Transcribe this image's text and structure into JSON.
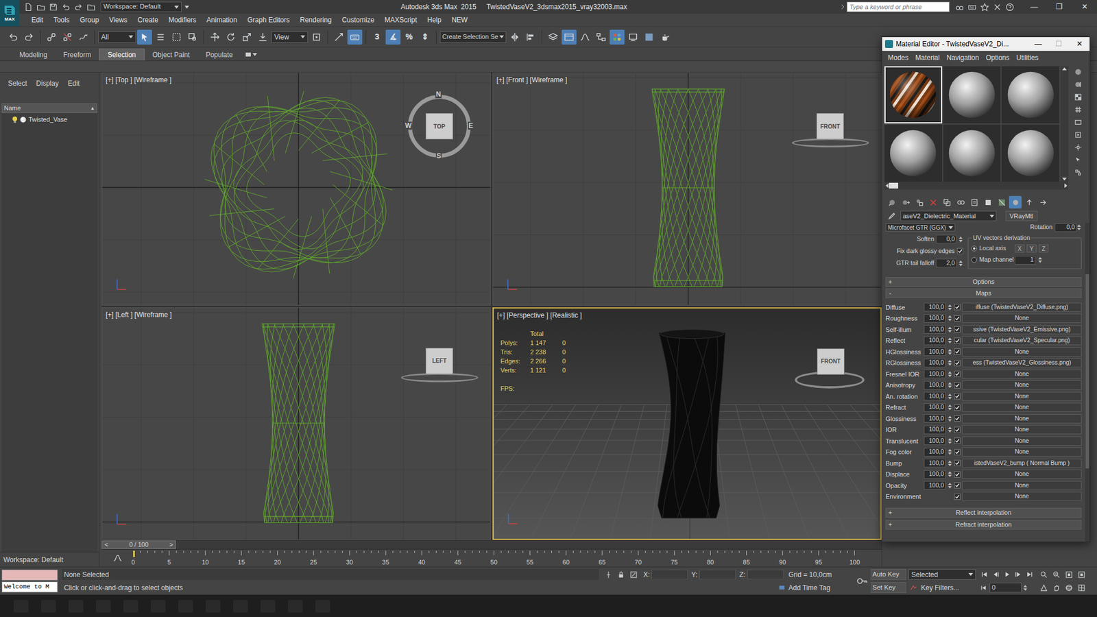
{
  "window": {
    "logo": "MAX",
    "workspace": "Workspace: Default",
    "title": "Autodesk 3ds Max  2015",
    "file": "TwistedVaseV2_3dsmax2015_vray32003.max",
    "search_placeholder": "Type a keyword or phrase",
    "controls": [
      "—",
      "❐",
      "✕"
    ]
  },
  "menu": [
    "Edit",
    "Tools",
    "Group",
    "Views",
    "Create",
    "Modifiers",
    "Animation",
    "Graph Editors",
    "Rendering",
    "Customize",
    "MAXScript",
    "Help",
    "NEW"
  ],
  "toolbar": {
    "filter": "All",
    "coord": "View",
    "snaps": [
      "3",
      "∡",
      "%",
      "⇕"
    ],
    "selection_set": "Create Selection Se"
  },
  "ribbon": {
    "tabs": [
      {
        "label": "Modeling",
        "selected": false
      },
      {
        "label": "Freeform",
        "selected": false
      },
      {
        "label": "Selection",
        "selected": true
      },
      {
        "label": "Object Paint",
        "selected": false
      },
      {
        "label": "Populate",
        "selected": false
      }
    ]
  },
  "scene_explorer": {
    "tabs": [
      "Select",
      "Display",
      "Edit"
    ],
    "column": "Name",
    "sort": "▲",
    "items": [
      {
        "name": "Twisted_Vase",
        "selected": false
      }
    ],
    "workspace": "Workspace: Default"
  },
  "viewports": [
    {
      "kind": "top",
      "label": "[+] [Top ] [Wireframe ]",
      "active": false,
      "cube": "TOP",
      "compass": [
        "N",
        "W",
        "E",
        "S"
      ]
    },
    {
      "kind": "front",
      "label": "[+] [Front ] [Wireframe ]",
      "active": false,
      "cube": "FRONT",
      "compass": []
    },
    {
      "kind": "left",
      "label": "[+] [Left ] [Wireframe ]",
      "active": false,
      "cube": "LEFT",
      "compass": []
    },
    {
      "kind": "perspective",
      "label": "[+] [Perspective ] [Realistic ]",
      "active": true,
      "cube": "FRONT",
      "compass": []
    }
  ],
  "stats": {
    "header": "Total",
    "rows": [
      {
        "label": "Polys:",
        "total": "1 147",
        "selected": "0"
      },
      {
        "label": "Tris:",
        "total": "2 238",
        "selected": "0"
      },
      {
        "label": "Edges:",
        "total": "2 266",
        "selected": "0"
      },
      {
        "label": "Verts:",
        "total": "1 121",
        "selected": "0"
      }
    ],
    "fps": "FPS:"
  },
  "timeline": {
    "prev": "<",
    "position": "0 / 100",
    "next": ">",
    "level": 0,
    "ticks": [
      "0",
      "5",
      "10",
      "15",
      "20",
      "25",
      "30",
      "35",
      "40",
      "45",
      "50",
      "55",
      "60",
      "65",
      "70",
      "75",
      "80",
      "85",
      "90",
      "95",
      "100"
    ]
  },
  "status": {
    "welcome": "Welcome to M",
    "selection": "None Selected",
    "prompt": "Click or click-and-drag to select objects",
    "coords": [
      "X:",
      "Y:",
      "Z:"
    ],
    "grid": "Grid = 10,0cm",
    "add_time_tag": "Add Time Tag",
    "auto_key": "Auto Key",
    "set_key": "Set Key",
    "key_mode": "Selected",
    "key_filters": "Key Filters...",
    "frame": "0"
  },
  "material_editor": {
    "title": "Material Editor - TwistedVaseV2_Di...",
    "controls": [
      "—",
      "☐",
      "✕"
    ],
    "menu": [
      "Modes",
      "Material",
      "Navigation",
      "Options",
      "Utilities"
    ],
    "slots": [
      {
        "kind": "textured",
        "selected": true
      },
      {
        "kind": "plain",
        "selected": false
      },
      {
        "kind": "plain",
        "selected": false
      },
      {
        "kind": "plain",
        "selected": false
      },
      {
        "kind": "plain",
        "selected": false
      },
      {
        "kind": "plain",
        "selected": false
      }
    ],
    "material_name": "aseV2_Dielectric_Material",
    "material_type": "VRayMtl",
    "brdf": "Microfacet GTR (GGX)",
    "rotation": {
      "label": "Rotation",
      "value": "0,0"
    },
    "soften": {
      "label": "Soften",
      "value": "0,0"
    },
    "fix_dark": {
      "label": "Fix dark glossy edges",
      "checked": true
    },
    "gtr_falloff": {
      "label": "GTR tail falloff",
      "value": "2,0"
    },
    "uv_group": "UV vectors derivation",
    "uv_options": [
      {
        "label": "Local axis",
        "selected": true,
        "kind": "axes"
      },
      {
        "label": "Map channel",
        "selected": false,
        "kind": "channel"
      }
    ],
    "axes": [
      "X",
      "Y",
      "Z"
    ],
    "map_channel": "1",
    "options_rollout": {
      "sign": "+",
      "label": "Options"
    },
    "maps_rollout": {
      "sign": "-",
      "label": "Maps"
    },
    "maps": [
      {
        "name": "Diffuse",
        "kind": "amount",
        "amount": "100,0",
        "enabled": true,
        "map": "iffuse (TwistedVaseV2_Diffuse.png)"
      },
      {
        "name": "Roughness",
        "kind": "amount",
        "amount": "100,0",
        "enabled": true,
        "map": "None"
      },
      {
        "name": "Self-illum",
        "kind": "amount",
        "amount": "100,0",
        "enabled": true,
        "map": "ssive (TwistedVaseV2_Emissive.png)"
      },
      {
        "name": "Reflect",
        "kind": "amount",
        "amount": "100,0",
        "enabled": true,
        "map": "cular (TwistedVaseV2_Specular.png)"
      },
      {
        "name": "HGlossiness",
        "kind": "amount",
        "amount": "100,0",
        "enabled": true,
        "map": "None"
      },
      {
        "name": "RGlossiness",
        "kind": "amount",
        "amount": "100,0",
        "enabled": true,
        "map": "ess (TwistedVaseV2_Glossiness.png)"
      },
      {
        "name": "Fresnel IOR",
        "kind": "amount",
        "amount": "100,0",
        "enabled": true,
        "map": "None"
      },
      {
        "name": "Anisotropy",
        "kind": "amount",
        "amount": "100,0",
        "enabled": true,
        "map": "None"
      },
      {
        "name": "An. rotation",
        "kind": "amount",
        "amount": "100,0",
        "enabled": true,
        "map": "None"
      },
      {
        "name": "Refract",
        "kind": "amount",
        "amount": "100,0",
        "enabled": true,
        "map": "None"
      },
      {
        "name": "Glossiness",
        "kind": "amount",
        "amount": "100,0",
        "enabled": true,
        "map": "None"
      },
      {
        "name": "IOR",
        "kind": "amount",
        "amount": "100,0",
        "enabled": true,
        "map": "None"
      },
      {
        "name": "Translucent",
        "kind": "amount",
        "amount": "100,0",
        "enabled": true,
        "map": "None"
      },
      {
        "name": "Fog color",
        "kind": "amount",
        "amount": "100,0",
        "enabled": true,
        "map": "None"
      },
      {
        "name": "Bump",
        "kind": "amount",
        "amount": "100,0",
        "enabled": true,
        "map": "istedVaseV2_bump ( Normal Bump )"
      },
      {
        "name": "Displace",
        "kind": "amount",
        "amount": "100,0",
        "enabled": true,
        "map": "None"
      },
      {
        "name": "Opacity",
        "kind": "amount",
        "amount": "100,0",
        "enabled": true,
        "map": "None"
      },
      {
        "name": "Environment",
        "kind": "plain",
        "enabled": true,
        "map": "None"
      }
    ],
    "bottom_rollouts": [
      {
        "sign": "+",
        "label": "Reflect interpolation"
      },
      {
        "sign": "+",
        "label": "Refract interpolation"
      }
    ]
  }
}
